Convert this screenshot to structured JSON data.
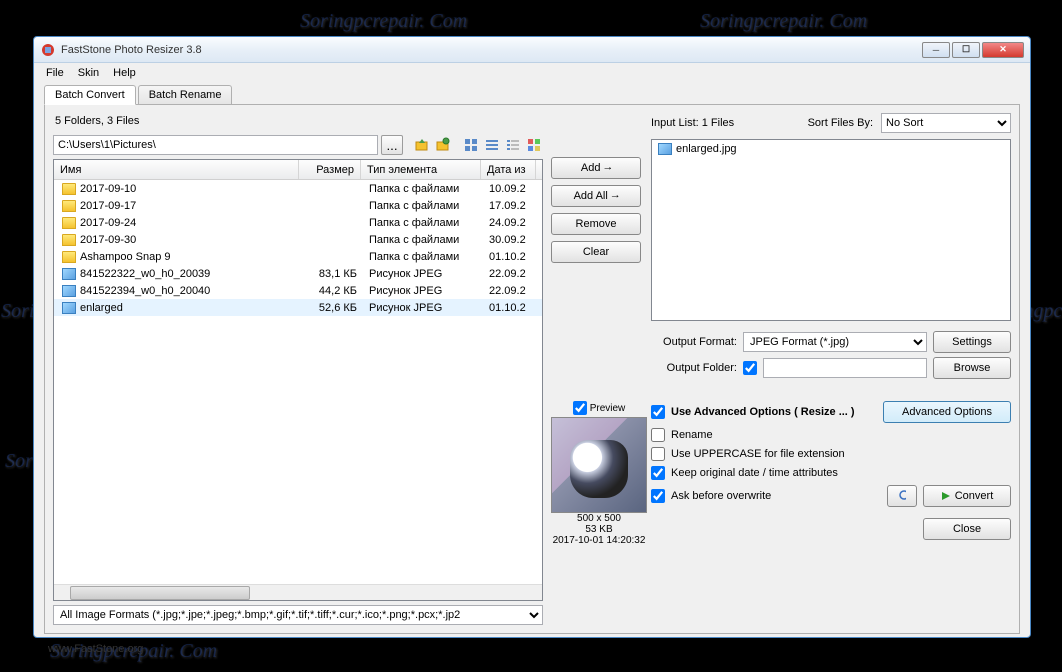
{
  "window": {
    "title": "FastStone Photo Resizer 3.8"
  },
  "menu": {
    "file": "File",
    "skin": "Skin",
    "help": "Help"
  },
  "tabs": {
    "convert": "Batch Convert",
    "rename": "Batch Rename"
  },
  "folder_info": "5 Folders, 3 Files",
  "path": "C:\\Users\\1\\Pictures\\",
  "columns": {
    "name": "Имя",
    "size": "Размер",
    "type": "Тип элемента",
    "date": "Дата из"
  },
  "files": [
    {
      "name": "2017-09-10",
      "size": "",
      "type": "Папка с файлами",
      "date": "10.09.2",
      "folder": true
    },
    {
      "name": "2017-09-17",
      "size": "",
      "type": "Папка с файлами",
      "date": "17.09.2",
      "folder": true
    },
    {
      "name": "2017-09-24",
      "size": "",
      "type": "Папка с файлами",
      "date": "24.09.2",
      "folder": true
    },
    {
      "name": "2017-09-30",
      "size": "",
      "type": "Папка с файлами",
      "date": "30.09.2",
      "folder": true
    },
    {
      "name": "Ashampoo Snap 9",
      "size": "",
      "type": "Папка с файлами",
      "date": "01.10.2",
      "folder": true
    },
    {
      "name": "841522322_w0_h0_20039",
      "size": "83,1 КБ",
      "type": "Рисунок JPEG",
      "date": "22.09.2",
      "folder": false
    },
    {
      "name": "841522394_w0_h0_20040",
      "size": "44,2 КБ",
      "type": "Рисунок JPEG",
      "date": "22.09.2",
      "folder": false
    },
    {
      "name": "enlarged",
      "size": "52,6 КБ",
      "type": "Рисунок JPEG",
      "date": "01.10.2",
      "folder": false,
      "selected": true
    }
  ],
  "format_filter": "All Image Formats (*.jpg;*.jpe;*.jpeg;*.bmp;*.gif;*.tif;*.tiff;*.cur;*.ico;*.png;*.pcx;*.jp2",
  "buttons": {
    "add": "Add",
    "add_all": "Add All",
    "remove": "Remove",
    "clear": "Clear",
    "settings": "Settings",
    "browse": "Browse",
    "adv": "Advanced Options",
    "convert": "Convert",
    "close": "Close",
    "browse_path": "..."
  },
  "input_list_label": "Input List:  1 Files",
  "input_items": [
    "enlarged.jpg"
  ],
  "sort_label": "Sort Files By:",
  "sort_value": "No Sort",
  "output_format_label": "Output Format:",
  "output_format_value": "JPEG Format (*.jpg)",
  "output_folder_label": "Output Folder:",
  "output_folder_value": "",
  "preview_label": "Preview",
  "preview_dim": "500 x 500",
  "preview_size": "53 KB",
  "preview_date": "2017-10-01 14:20:32",
  "options": {
    "use_adv": "Use Advanced Options ( Resize ... )",
    "rename": "Rename",
    "uppercase": "Use UPPERCASE for file extension",
    "keep_date": "Keep original date / time attributes",
    "ask_overwrite": "Ask before overwrite"
  },
  "status": "www.FastStone.org",
  "watermark_text": "Soringpcrepair. Com"
}
